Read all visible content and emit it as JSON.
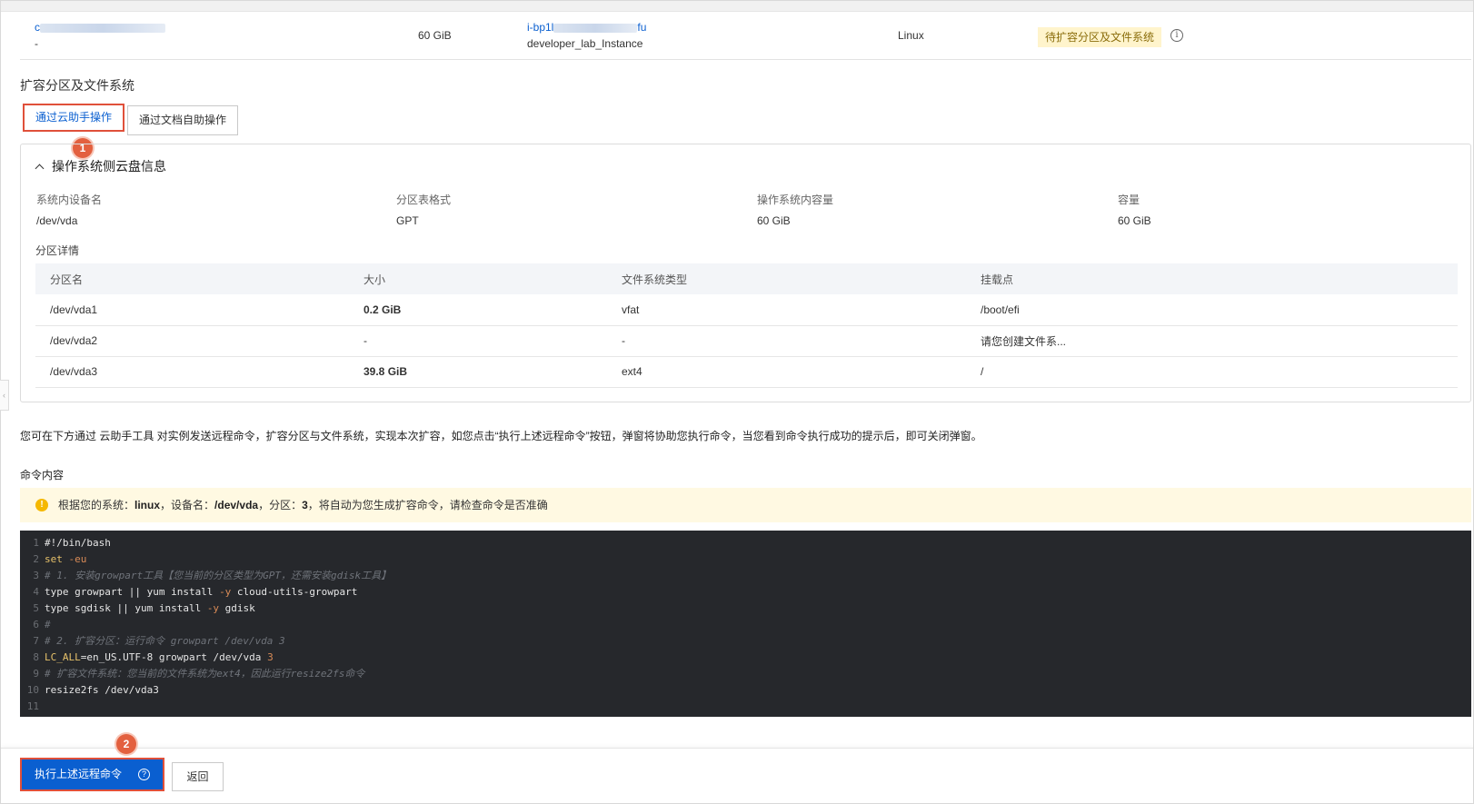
{
  "disk_row": {
    "id_prefix": "c",
    "sub_dash": "-",
    "size": "60 GiB",
    "instance_id_prefix": "i-bp1l",
    "instance_id_suffix": "fu",
    "instance_name": "developer_lab_Instance",
    "os": "Linux",
    "status": "待扩容分区及文件系统",
    "info_icon": "i"
  },
  "section_title": "扩容分区及文件系统",
  "tabs": [
    {
      "label": "通过云助手操作",
      "active": true
    },
    {
      "label": "通过文档自助操作",
      "active": false
    }
  ],
  "badges": {
    "step1": "1",
    "step2": "2"
  },
  "panel": {
    "title": "操作系统侧云盘信息",
    "info": [
      {
        "label": "系统内设备名",
        "value": "/dev/vda"
      },
      {
        "label": "分区表格式",
        "value": "GPT"
      },
      {
        "label": "操作系统内容量",
        "value": "60 GiB"
      },
      {
        "label": "容量",
        "value": "60 GiB"
      }
    ],
    "partition_title": "分区详情",
    "columns": [
      "分区名",
      "大小",
      "文件系统类型",
      "挂载点"
    ],
    "rows": [
      [
        "/dev/vda1",
        "0.2 GiB",
        "vfat",
        "/boot/efi"
      ],
      [
        "/dev/vda2",
        "-",
        "-",
        "请您创建文件系..."
      ],
      [
        "/dev/vda3",
        "39.8 GiB",
        "ext4",
        "/"
      ]
    ]
  },
  "description": "您可在下方通过 云助手工具 对实例发送远程命令，扩容分区与文件系统，实现本次扩容，如您点击“执行上述远程命令”按钮，弹窗将协助您执行命令，当您看到命令执行成功的提示后，即可关闭弹窗。",
  "command_title": "命令内容",
  "alert": {
    "prefix": "根据您的系统：",
    "system": "linux",
    "mid1": "，设备名：",
    "device": "/dev/vda",
    "mid2": "，分区：",
    "partition": "3",
    "suffix": "，将自动为您生成扩容命令，请检查命令是否准确"
  },
  "code_lines": [
    "#!/bin/bash",
    "set -eu",
    "# 1. 安装growpart工具【您当前的分区类型为GPT，还需安装gdisk工具】",
    "type growpart || yum install -y cloud-utils-growpart",
    "type sgdisk || yum install -y gdisk",
    "#",
    "# 2. 扩容分区：运行命令 growpart /dev/vda 3",
    "LC_ALL=en_US.UTF-8 growpart /dev/vda 3",
    "# 扩容文件系统：您当前的文件系统为ext4，因此运行resize2fs命令",
    "resize2fs /dev/vda3",
    ""
  ],
  "footer": {
    "execute_label": "执行上述远程命令",
    "help_icon": "?",
    "back_label": "返回"
  },
  "colors": {
    "primary": "#0a5fd0",
    "highlight": "#e0503a",
    "warn_bg": "#fff4cc",
    "code_bg": "#26282c"
  }
}
